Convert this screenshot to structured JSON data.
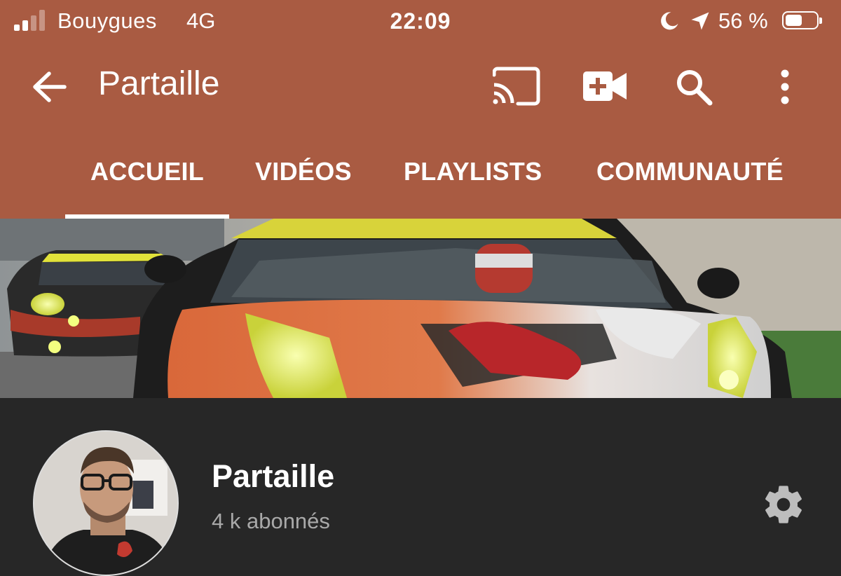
{
  "status_bar": {
    "carrier": "Bouygues",
    "network": "4G",
    "time": "22:09",
    "battery_percent": "56 %",
    "battery_level": 0.56,
    "signal_bars_active": 2,
    "signal_bars_total": 4
  },
  "app_bar": {
    "title": "Partaille",
    "icons": [
      "back-arrow-icon",
      "cast-icon",
      "video-add-icon",
      "search-icon",
      "more-vert-icon"
    ]
  },
  "tabs": [
    {
      "label": "ACCUEIL",
      "active": true
    },
    {
      "label": "VIDÉOS",
      "active": false
    },
    {
      "label": "PLAYLISTS",
      "active": false
    },
    {
      "label": "COMMUNAUTÉ",
      "active": false
    }
  ],
  "channel": {
    "name": "Partaille",
    "subscribers": "4 k abonnés"
  },
  "colors": {
    "header": "#A95B42",
    "background": "#272727",
    "text": "#FFFFFF",
    "secondary_text": "#A9A9A9"
  }
}
